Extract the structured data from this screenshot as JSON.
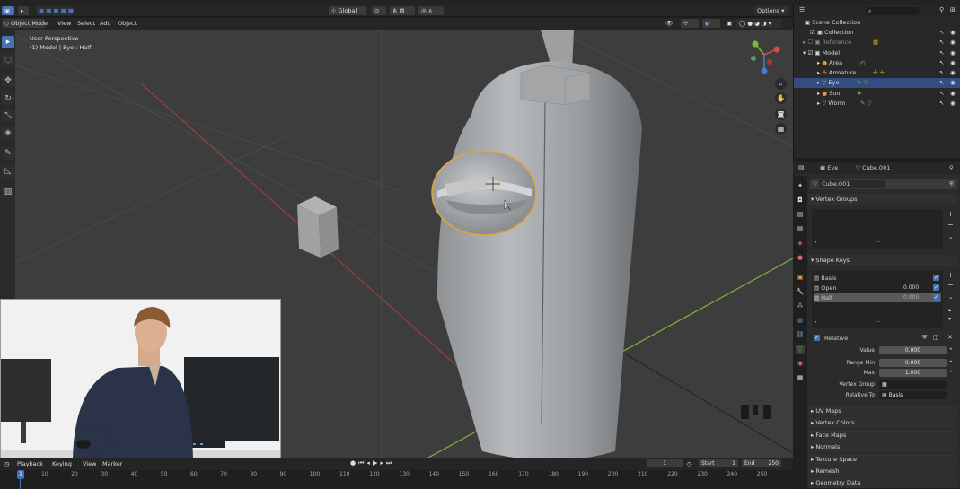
{
  "header": {
    "mode": "Object Mode",
    "menus": [
      "View",
      "Select",
      "Add",
      "Object"
    ],
    "orientation": "Global",
    "options": "Options"
  },
  "viewport": {
    "view_name": "User Perspective",
    "selection_info": "(1) Model | Eye : Half"
  },
  "outliner": {
    "search_placeholder": "",
    "rows": [
      {
        "label": "Scene Collection",
        "selected": false
      },
      {
        "label": "Collection",
        "selected": false
      },
      {
        "label": "Reference",
        "selected": false
      },
      {
        "label": "Model",
        "selected": false
      },
      {
        "label": "Area",
        "selected": false
      },
      {
        "label": "Armature",
        "selected": false
      },
      {
        "label": "Eye",
        "selected": true
      },
      {
        "label": "Sun",
        "selected": false
      },
      {
        "label": "Worm",
        "selected": false
      }
    ]
  },
  "properties": {
    "object_name": "Eye",
    "mesh_name": "Cube.001",
    "data_block": "Cube.001",
    "sections": {
      "vertex_groups": "Vertex Groups",
      "shape_keys": "Shape Keys"
    },
    "shape_keys": [
      {
        "name": "Basis",
        "value": "",
        "checked": true,
        "active": false
      },
      {
        "name": "Open",
        "value": "0.000",
        "checked": true,
        "active": false
      },
      {
        "name": "Half",
        "value": "0.000",
        "checked": true,
        "active": true
      }
    ],
    "relative_label": "Relative",
    "value": {
      "label": "Value",
      "value": "0.000"
    },
    "range_min": {
      "label": "Range Min",
      "value": "0.000"
    },
    "max": {
      "label": "Max",
      "value": "1.000"
    },
    "vertex_group": {
      "label": "Vertex Group",
      "value": ""
    },
    "relative_to": {
      "label": "Relative To",
      "value": "Basis"
    },
    "collapsed_sections": [
      "UV Maps",
      "Vertex Colors",
      "Face Maps",
      "Normals",
      "Texture Space",
      "Remesh",
      "Geometry Data"
    ]
  },
  "timeline": {
    "menus": [
      "Playback",
      "Keying",
      "View",
      "Marker"
    ],
    "current_frame": "1",
    "start_label": "Start",
    "start": "1",
    "end_label": "End",
    "end": "250",
    "ruler": [
      "1",
      "10",
      "20",
      "30",
      "40",
      "50",
      "60",
      "70",
      "80",
      "90",
      "100",
      "110",
      "120",
      "130",
      "140",
      "150",
      "160",
      "170",
      "180",
      "190",
      "200",
      "210",
      "220",
      "230",
      "240",
      "250"
    ]
  },
  "colors": {
    "accent": "#4772b3",
    "selection_outline": "#e5a43a",
    "viewport_bg": "#3d3d3d",
    "x_axis": "#b04040",
    "y_axis": "#7fb53b"
  }
}
